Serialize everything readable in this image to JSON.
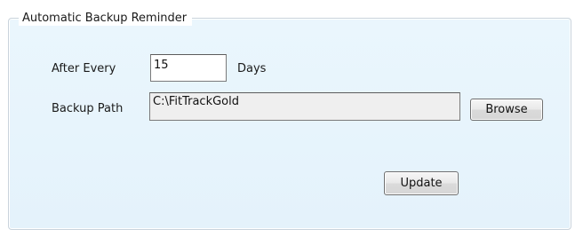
{
  "backup_reminder": {
    "group_title": "Automatic Backup Reminder",
    "after_every_label": "After Every",
    "after_every_value": "15",
    "days_label": "Days",
    "backup_path_label": "Backup Path",
    "backup_path_value": "C:\\FitTrackGold",
    "browse_label": "Browse",
    "update_label": "Update"
  }
}
